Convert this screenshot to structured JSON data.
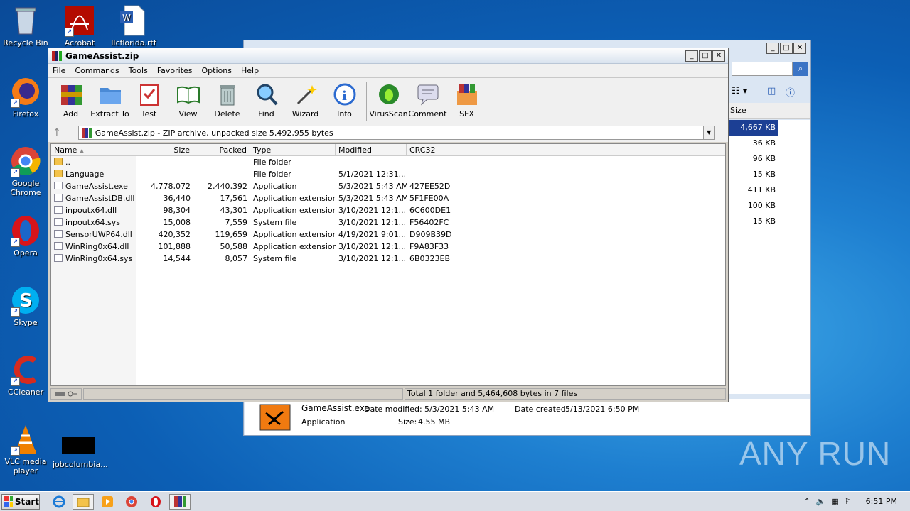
{
  "desktop": {
    "icons": [
      {
        "label": "Recycle Bin",
        "name": "recycle-bin-icon"
      },
      {
        "label": "Acrobat",
        "name": "acrobat-icon"
      },
      {
        "label": "llcflorida.rtf",
        "name": "word-document-icon"
      },
      {
        "label": "Firefox",
        "name": "firefox-icon"
      },
      {
        "label": "Google Chrome",
        "name": "chrome-icon"
      },
      {
        "label": "Opera",
        "name": "opera-icon"
      },
      {
        "label": "Skype",
        "name": "skype-icon"
      },
      {
        "label": "CCleaner",
        "name": "ccleaner-icon"
      },
      {
        "label": "VLC media player",
        "name": "vlc-icon"
      },
      {
        "label": "jobcolumbia...",
        "name": "file-thumbnail-icon"
      }
    ],
    "watermark": "ANY RUN"
  },
  "bg_window": {
    "sizes": [
      "4,667 KB",
      "36 KB",
      "96 KB",
      "15 KB",
      "411 KB",
      "100 KB",
      "15 KB"
    ],
    "col_size": "Size",
    "details": {
      "filename": "GameAssist.exe",
      "modified_label": "Date modified:",
      "modified": "5/3/2021 5:43 AM",
      "created_label": "Date created:",
      "created": "5/13/2021 6:50 PM",
      "type": "Application",
      "size_label": "Size:",
      "size": "4.55 MB"
    }
  },
  "window": {
    "title": "GameAssist.zip",
    "menu": [
      "File",
      "Commands",
      "Tools",
      "Favorites",
      "Options",
      "Help"
    ],
    "toolbar": [
      "Add",
      "Extract To",
      "Test",
      "View",
      "Delete",
      "Find",
      "Wizard",
      "Info",
      "VirusScan",
      "Comment",
      "SFX"
    ],
    "address": "GameAssist.zip - ZIP archive, unpacked size 5,492,955 bytes",
    "columns": [
      "Name",
      "Size",
      "Packed",
      "Type",
      "Modified",
      "CRC32"
    ],
    "rows": [
      [
        "..",
        "",
        "",
        "File folder",
        "",
        ""
      ],
      [
        "Language",
        "",
        "",
        "File folder",
        "5/1/2021 12:31...",
        ""
      ],
      [
        "GameAssist.exe",
        "4,778,072",
        "2,440,392",
        "Application",
        "5/3/2021 5:43 AM",
        "427EE52D"
      ],
      [
        "GameAssistDB.dll",
        "36,440",
        "17,561",
        "Application extension",
        "5/3/2021 5:43 AM",
        "5F1FE00A"
      ],
      [
        "inpoutx64.dll",
        "98,304",
        "43,301",
        "Application extension",
        "3/10/2021 12:1...",
        "6C600DE1"
      ],
      [
        "inpoutx64.sys",
        "15,008",
        "7,559",
        "System file",
        "3/10/2021 12:1...",
        "F56402FC"
      ],
      [
        "SensorUWP64.dll",
        "420,352",
        "119,659",
        "Application extension",
        "4/19/2021 9:01...",
        "D909B39D"
      ],
      [
        "WinRing0x64.dll",
        "101,888",
        "50,588",
        "Application extension",
        "3/10/2021 12:1...",
        "F9A83F33"
      ],
      [
        "WinRing0x64.sys",
        "14,544",
        "8,057",
        "System file",
        "3/10/2021 12:1...",
        "6B0323EB"
      ]
    ],
    "status": "Total 1 folder and 5,464,608 bytes in 7 files"
  },
  "taskbar": {
    "start": "Start",
    "clock": "6:51 PM"
  }
}
